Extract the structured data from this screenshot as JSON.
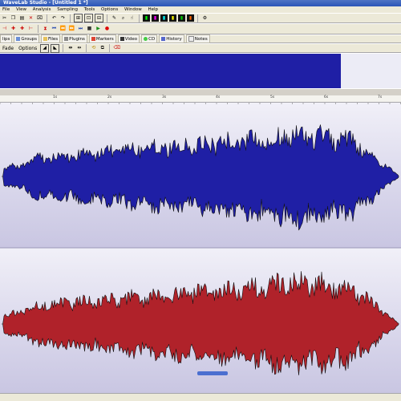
{
  "window": {
    "title": "WaveLab Studio - [Untitled 1 *]"
  },
  "menu": [
    "File",
    "View",
    "Analysis",
    "Sampling",
    "Tools",
    "Options",
    "Window",
    "Help"
  ],
  "toolbar2": {
    "icons": [
      "record-icon",
      "play-icon",
      "stop-icon",
      "loop-icon"
    ]
  },
  "tabs": [
    {
      "label": "lips"
    },
    {
      "label": "Groups"
    },
    {
      "label": "Files"
    },
    {
      "label": "Plugins"
    },
    {
      "label": "Markers"
    },
    {
      "label": "Video"
    },
    {
      "label": "CD"
    },
    {
      "label": "History"
    },
    {
      "label": "Notes"
    }
  ],
  "tb4": {
    "fade": "Fade",
    "options": "Options"
  },
  "ruler": {
    "labels": [
      "1s",
      "2s",
      "3s",
      "4s",
      "5s",
      "6s",
      "7s"
    ]
  },
  "colors": {
    "left_channel": "#1f1fa5",
    "right_channel": "#b0222a",
    "overview_selection": "#1f1fa5",
    "wave_bg_top": "#efeef8",
    "wave_bg_bottom": "#cfcde6"
  }
}
